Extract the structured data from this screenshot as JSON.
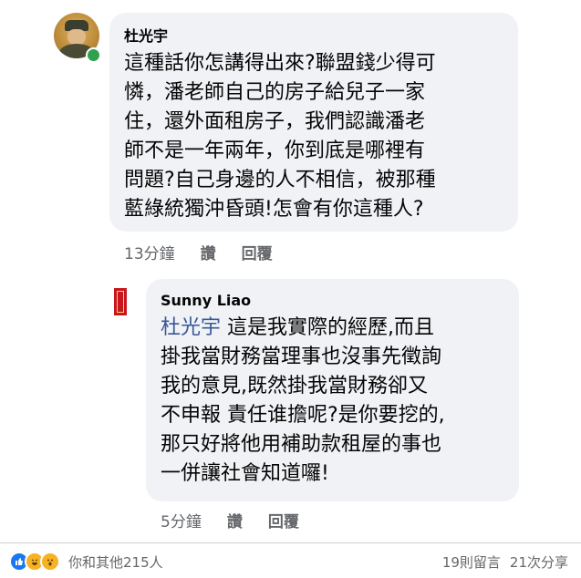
{
  "comment1": {
    "author": "杜光宇",
    "text": "這種話你怎講得出來?聯盟錢少得可\n憐，潘老師自己的房子給兒子一家\n住，還外面租房子，我們認識潘老\n師不是一年兩年，你到底是哪裡有\n問題?自己身邊的人不相信，被那種\n藍綠統獨沖昏頭!怎會有你這種人?",
    "time": "13分鐘",
    "like_label": "讚",
    "reply_label": "回覆"
  },
  "comment2": {
    "author": "Sunny  Liao",
    "mention": "杜光宇",
    "text_first": " 這是我實際的經歷,而且",
    "text_rest": "掛我當財務當理事也沒事先徵詢\n我的意見,既然掛我當財務卻又\n不申報 責任谁擔呢?是你要挖的,\n那只好將他用補助款租屋的事也\n一併讓社會知道囉!",
    "time": "5分鐘",
    "like_label": "讚",
    "reply_label": "回覆"
  },
  "footer": {
    "reactions": [
      "like-icon",
      "haha-icon",
      "wow-icon"
    ],
    "reaction_text": "你和其他215人",
    "comments": "19則留言",
    "shares": "21次分享"
  },
  "colors": {
    "bubble": "#f0f2f5",
    "mention": "#385898",
    "meta": "#65676b",
    "online": "#31a24c",
    "like": "#1877f2"
  }
}
